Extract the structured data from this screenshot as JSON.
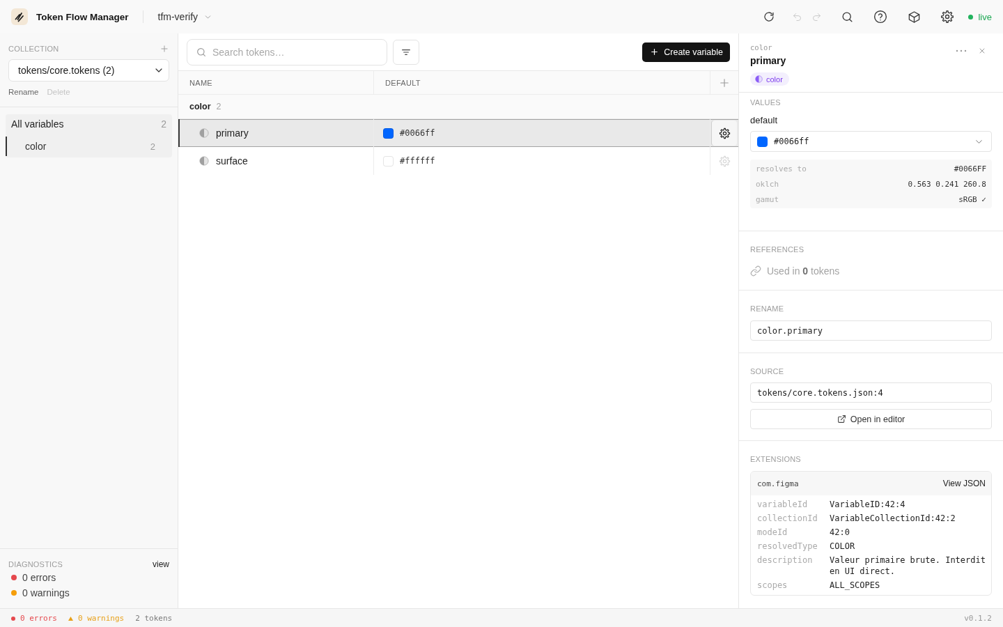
{
  "app": {
    "title": "Token Flow Manager",
    "project": "tfm-verify",
    "status": {
      "label": "live",
      "on": true
    },
    "actions": [
      {
        "kind": "refresh",
        "disabled": false
      },
      {
        "kind": "undo",
        "disabled": true
      },
      {
        "kind": "redo",
        "disabled": true
      },
      {
        "kind": "search",
        "disabled": false
      },
      {
        "kind": "help",
        "disabled": false
      },
      {
        "kind": "cube",
        "disabled": false
      },
      {
        "kind": "settings",
        "disabled": false
      }
    ]
  },
  "sidebar": {
    "collection": {
      "label": "COLLECTION",
      "value": "tokens/core.tokens (2)",
      "actions": [
        {
          "label": "Rename",
          "disabled": false
        },
        {
          "label": "Delete",
          "disabled": true
        }
      ]
    },
    "items": [
      {
        "label": "All variables",
        "count": "2",
        "selected": false,
        "children": [
          {
            "label": "color",
            "count": "2",
            "selected": true
          }
        ]
      }
    ],
    "diagnostics": {
      "title": "DIAGNOSTICS",
      "link": "view",
      "items": [
        {
          "label": "0 errors",
          "color": "#e5484d"
        },
        {
          "label": "0 warnings",
          "color": "#f59e0b"
        }
      ]
    }
  },
  "table": {
    "search": {
      "placeholder": "Search tokens…"
    },
    "create_button": "Create variable",
    "columns": [
      "NAME",
      "DEFAULT"
    ],
    "groups": [
      {
        "name": "color",
        "count": "2",
        "rows": [
          {
            "name": "primary",
            "value": "#0066ff",
            "color": "#0066ff",
            "selected": true
          },
          {
            "name": "surface",
            "value": "#ffffff",
            "color": "#ffffff",
            "selected": false
          }
        ]
      }
    ]
  },
  "inspector": {
    "path": "color",
    "name": "primary",
    "badge": "color",
    "values": {
      "title": "VALUES",
      "mode": "default",
      "value": "#0066ff",
      "color": "#0066ff",
      "details": [
        {
          "key": "resolves to",
          "value": "#0066FF"
        },
        {
          "key": "oklch",
          "value": "0.563 0.241 260.8"
        },
        {
          "key": "gamut",
          "value": "sRGB ✓"
        }
      ]
    },
    "references": {
      "title": "REFERENCES",
      "text": "Used in **0** tokens"
    },
    "rename": {
      "title": "RENAME",
      "value": "color.primary"
    },
    "source": {
      "title": "SOURCE",
      "value": "tokens/core.tokens.json:4",
      "button": "Open in editor"
    },
    "extensions": {
      "title": "EXTENSIONS",
      "items": [
        {
          "namespace": "com.figma",
          "link": "View JSON",
          "fields": [
            {
              "key": "variableId",
              "value": "VariableID:42:4"
            },
            {
              "key": "collectionId",
              "value": "VariableCollectionId:42:2"
            },
            {
              "key": "modeId",
              "value": "42:0"
            },
            {
              "key": "resolvedType",
              "value": "COLOR"
            },
            {
              "key": "description",
              "value": "Valeur primaire brute. Interdit en UI direct."
            },
            {
              "key": "scopes",
              "value": "ALL_SCOPES"
            }
          ]
        }
      ]
    }
  },
  "status_bar": {
    "items": [
      {
        "kind": "error",
        "label": "0 errors"
      },
      {
        "kind": "warning",
        "label": "0 warnings"
      },
      {
        "kind": "count",
        "label": "2 tokens"
      }
    ],
    "version": "v0.1.2"
  }
}
